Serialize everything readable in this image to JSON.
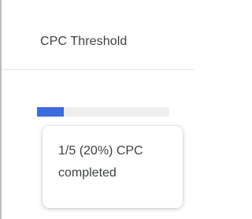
{
  "header": {
    "title": "CPC Threshold"
  },
  "progress": {
    "completed": 1,
    "total": 5,
    "fraction": 0.2,
    "fill_color": "#3d6be0",
    "track_color": "#eeeeee"
  },
  "tooltip": {
    "line1": "1/5 (20%) CPC",
    "line2": "completed"
  }
}
